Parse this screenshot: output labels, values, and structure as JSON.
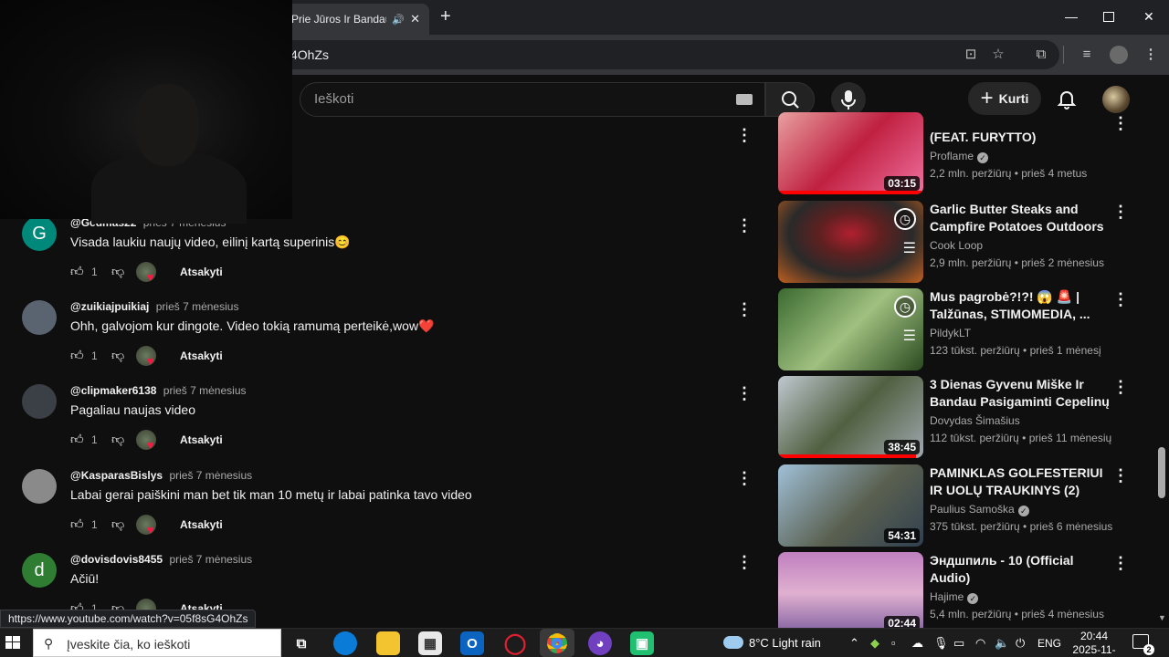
{
  "browser": {
    "tab_title": "Prie Jūros Ir Bandau",
    "url_fragment": "4OhZs",
    "status_url": "https://www.youtube.com/watch?v=05f8sG4OhZs"
  },
  "header": {
    "search_placeholder": "Ieškoti",
    "create_label": "Kurti"
  },
  "comments": [
    {
      "user": "@Gedmas22",
      "time": "prieš 7 mėnesius",
      "text": "Visada laukiu naujų video, eilinį kartą superinis😊",
      "likes": "1",
      "reply": "Atsakyti",
      "avatar_letter": "G",
      "avatar_color": "#00897b"
    },
    {
      "user": "@zuikiajpuikiaj",
      "time": "prieš 7 mėnesius",
      "text": "Ohh, galvojom kur dingote. Video tokią ramumą perteikė,wow❤️",
      "likes": "1",
      "reply": "Atsakyti",
      "avatar_letter": "",
      "avatar_color": "#5a6470"
    },
    {
      "user": "@clipmaker6138",
      "time": "prieš 7 mėnesius",
      "text": "Pagaliau naujas video",
      "likes": "1",
      "reply": "Atsakyti",
      "avatar_letter": "",
      "avatar_color": "#3a4046"
    },
    {
      "user": "@KasparasBislys",
      "time": "prieš 7 mėnesius",
      "text": "Labai gerai paiškini man  bet tik man 10 metų ir labai patinka tavo video",
      "likes": "1",
      "reply": "Atsakyti",
      "avatar_letter": "",
      "avatar_color": "#8a8a8a"
    },
    {
      "user": "@dovisdovis8455",
      "time": "prieš 7 mėnesius",
      "text": "Ačiū!",
      "likes": "1",
      "reply": "Atsakyti",
      "avatar_letter": "d",
      "avatar_color": "#2e7d32"
    }
  ],
  "videos": [
    {
      "title": "(FEAT. FURYTTO)",
      "channel": "Proflame",
      "verified": true,
      "meta": "2,2 mln. peržiūrų • prieš 4 metus",
      "duration": "03:15",
      "progress": 1.0,
      "watch_later": false,
      "thumb": "linear-gradient(135deg,#e8a0a0,#c02040 50%,#f070a0)"
    },
    {
      "title": "Garlic Butter Steaks and Campfire Potatoes Outdoors",
      "channel": "Cook Loop",
      "verified": false,
      "meta": "2,9 mln. peržiūrų • prieš 2 mėnesius",
      "duration": "",
      "progress": 0,
      "watch_later": true,
      "thumb": "radial-gradient(ellipse at 50% 40%,#b02030 0%,#602020 30%,#2a2a2a 60%,#c06020 100%)"
    },
    {
      "title": "Mus pagrobė?!?! 😱 🚨 | Talžūnas,  STIMOMEDIA, ...",
      "channel": "PildykLT",
      "verified": false,
      "meta": "123 tūkst. peržiūrų • prieš 1 mėnesį",
      "duration": "",
      "progress": 0,
      "watch_later": true,
      "thumb": "linear-gradient(135deg,#3a6a30,#a0c080 50%,#2a4a20)"
    },
    {
      "title": "3 Dienas Gyvenu Miške Ir Bandau Pasigaminti Cepelinų",
      "channel": "Dovydas Šimašius",
      "verified": false,
      "meta": "112 tūkst. peržiūrų • prieš 11 mėnesių",
      "duration": "38:45",
      "progress": 0.95,
      "watch_later": false,
      "thumb": "linear-gradient(135deg,#c0c8d0,#506040 50%,#a0a8b0)"
    },
    {
      "title": "PAMINKLAS GOLFESTERIUI IR UOLŲ TRAUKINYS (2)",
      "channel": "Paulius Samoška",
      "verified": true,
      "meta": "375 tūkst. peržiūrų • prieš 6 mėnesius",
      "duration": "54:31",
      "progress": 0,
      "watch_later": false,
      "thumb": "linear-gradient(135deg,#a0c0d8,#5a6050 55%,#304050)"
    },
    {
      "title": "Эндшпиль - 10 (Official Audio)",
      "channel": "Hajime",
      "verified": true,
      "meta": "5,4 mln. peržiūrų • prieš 4 mėnesius",
      "duration": "02:44",
      "progress": 0,
      "watch_later": false,
      "thumb": "linear-gradient(180deg,#c080c0,#e0b0d0 50%,#8060a0)"
    }
  ],
  "taskbar": {
    "search_placeholder": "Įveskite čia, ko ieškoti",
    "weather": "8°C  Light rain",
    "lang": "ENG",
    "time": "20:44",
    "date": "2025-11-03",
    "notifications": "2"
  }
}
